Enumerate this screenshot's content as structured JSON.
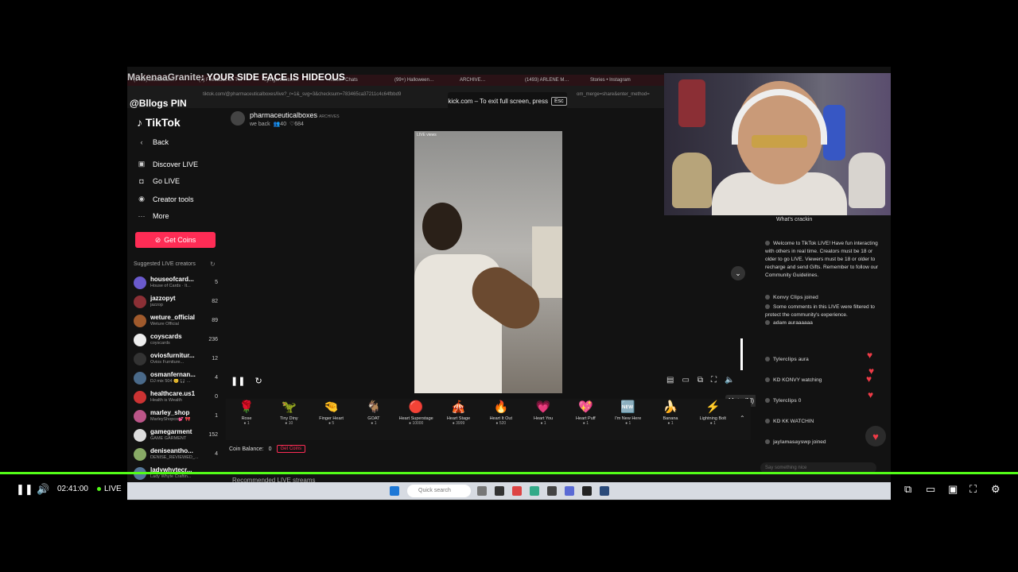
{
  "overlay": {
    "banner_name": "MakenaaGranite",
    "banner_message": ": YOUR SIDE FACE IS HIDEOUS",
    "banner_handle": "@Bllogs PIN",
    "fullscreen_note": "kick.com – To exit full screen, press",
    "fullscreen_key": "Esc"
  },
  "browser": {
    "tabs": [
      "(1493) Bloodhoun…",
      "(7) Feedback on T…",
      "dyingonfenton…",
      "Inbox • Chats",
      "(99+) Halloween…",
      "ARCHIVE…",
      "(1493) ARLENE M…",
      "Stories • Instagram"
    ],
    "url": "tiktok.com/@pharmaceuticalboxes/live?_r=1&_svg=3&checksum=783465ca37211c4c64fbbd9",
    "url_tail": "om_merge=share&enter_method="
  },
  "tiktok": {
    "logo": "TikTok",
    "nav": [
      {
        "label": "Back",
        "icon": "back-arrow-icon"
      },
      {
        "label": "Discover LIVE",
        "icon": "live-icon"
      },
      {
        "label": "Go LIVE",
        "icon": "camera-icon"
      },
      {
        "label": "Creator tools",
        "icon": "lightbulb-icon"
      },
      {
        "label": "More",
        "icon": "more-icon"
      }
    ],
    "get_coins": "Get Coins",
    "suggested_title": "Suggested LIVE creators",
    "creators": [
      {
        "name": "houseofcard...",
        "sub": "House of Cards · It...",
        "count": "5",
        "color": "#6a5acd"
      },
      {
        "name": "jazzopyt",
        "sub": "jazzop",
        "count": "82",
        "color": "#8b2f35"
      },
      {
        "name": "weture_official",
        "sub": "Weture Official",
        "count": "89",
        "color": "#a05a2c"
      },
      {
        "name": "coyscards",
        "sub": "coyscards",
        "count": "236",
        "color": "#eee"
      },
      {
        "name": "oviosfurnitur...",
        "sub": "Ovios Furniture...",
        "count": "12",
        "color": "#333"
      },
      {
        "name": "osmanfernan...",
        "sub": "DJ mix 504 😊 🎧 ...",
        "count": "4",
        "color": "#4a6a8a"
      },
      {
        "name": "healthcare.us1",
        "sub": "Health is Wealth",
        "count": "0",
        "color": "#c33"
      },
      {
        "name": "marley_shop",
        "sub": "MarleyShopco💕 🎀",
        "count": "1",
        "color": "#b58"
      },
      {
        "name": "gamegarment",
        "sub": "GAME GARMENT",
        "count": "152",
        "color": "#ddd"
      },
      {
        "name": "deniseantho...",
        "sub": "DENISE_REVIEWED_...",
        "count": "4",
        "color": "#8a6"
      },
      {
        "name": "ladywhytecr...",
        "sub": "Lady Whyte Craftin...",
        "count": "",
        "color": "#579"
      }
    ],
    "streamer_name": "pharmaceuticalboxes",
    "streamer_tag": "ARCHIVES",
    "streamer_status": "we back",
    "viewers": "40",
    "likes": "684",
    "video_tag": "LIVE views",
    "mute_tooltip": "Mute (M)",
    "gifts": [
      {
        "name": "Rose",
        "icon": "🌹",
        "cost": "1"
      },
      {
        "name": "Tiny Diny",
        "icon": "🦖",
        "cost": "10"
      },
      {
        "name": "Finger Heart",
        "icon": "🤏",
        "cost": "5"
      },
      {
        "name": "GOAT",
        "icon": "🐐",
        "cost": "1"
      },
      {
        "name": "Heart Superstage",
        "icon": "🔴",
        "cost": "10000"
      },
      {
        "name": "Heart Stage",
        "icon": "🎪",
        "cost": "3999"
      },
      {
        "name": "Heart It Out",
        "icon": "🔥",
        "cost": "520"
      },
      {
        "name": "Heart You",
        "icon": "💗",
        "cost": "1"
      },
      {
        "name": "Heart Puff",
        "icon": "💖",
        "cost": "1"
      },
      {
        "name": "I'm New Here",
        "icon": "🆕",
        "cost": "1"
      },
      {
        "name": "Banana",
        "icon": "🍌",
        "cost": "1"
      },
      {
        "name": "Lightning Bolt",
        "icon": "⚡",
        "cost": "1"
      }
    ],
    "coin_balance_label": "Coin Balance:",
    "coin_balance": "0",
    "get_coins_small": "Get Coins",
    "recommended": "Recommended LIVE streams",
    "chat_header": "What's crackin",
    "chat": [
      {
        "user": "",
        "text": "Welcome to TikTok LIVE! Have fun interacting with others in real time. Creators must be 18 or older to go LIVE. Viewers must be 18 or older to recharge and send Gifts. Remember to follow our Community Guidelines."
      },
      {
        "user": "Konvy Clips",
        "text": "joined"
      },
      {
        "user": "",
        "text": "Some comments in this LIVE were filtered to protect the community's experience."
      },
      {
        "user": "adam",
        "text": "auraaaaaa"
      },
      {
        "user": "Tylerclips",
        "text": "aura"
      },
      {
        "user": "KD",
        "text": "KONVY watching"
      },
      {
        "user": "Tylerclips",
        "text": "0"
      },
      {
        "user": "KD",
        "text": "KK WATCHIN"
      },
      {
        "user": "jaylamasayswp",
        "text": "joined"
      }
    ],
    "chat_placeholder": "Say something nice"
  },
  "windows": {
    "search_placeholder": "Quick search"
  },
  "player": {
    "time": "02:41:00",
    "live": "LIVE",
    "progress": 1.0
  }
}
